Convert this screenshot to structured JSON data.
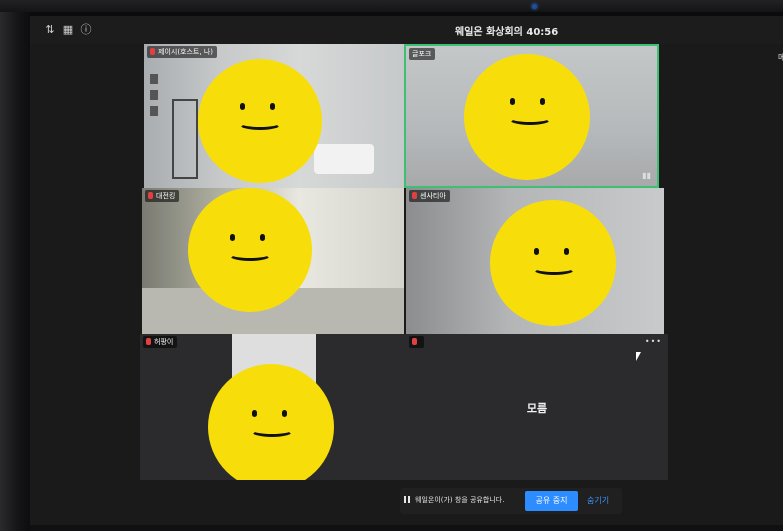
{
  "meeting": {
    "title": "웨일온 화상회의",
    "timer": "40:56"
  },
  "toolbar_icons": [
    "sort-icon",
    "grid-icon",
    "info-icon"
  ],
  "participants": [
    {
      "name": "제이시(호스트, 나)",
      "muted": true,
      "video": true,
      "active_speaker": false
    },
    {
      "name": "글포크",
      "muted": false,
      "video": true,
      "active_speaker": true
    },
    {
      "name": "대전킹",
      "muted": true,
      "video": true,
      "active_speaker": false
    },
    {
      "name": "센사티아",
      "muted": true,
      "video": true,
      "active_speaker": false
    },
    {
      "name": "허팡이",
      "muted": true,
      "video": true,
      "active_speaker": false
    },
    {
      "name": "",
      "muted": true,
      "video": false,
      "active_speaker": false,
      "center_label": "모름"
    }
  ],
  "share_bar": {
    "message": "웨일온이(가) 창을 공유합니다.",
    "stop_label": "공유 중지",
    "hide_label": "숨기기"
  },
  "side_hint": "메",
  "more_label": "•••",
  "colors": {
    "accent": "#2d8cff",
    "active_border": "#3fbf74",
    "avatar_yellow": "#f7de0b",
    "mic_muted": "#e04040"
  }
}
